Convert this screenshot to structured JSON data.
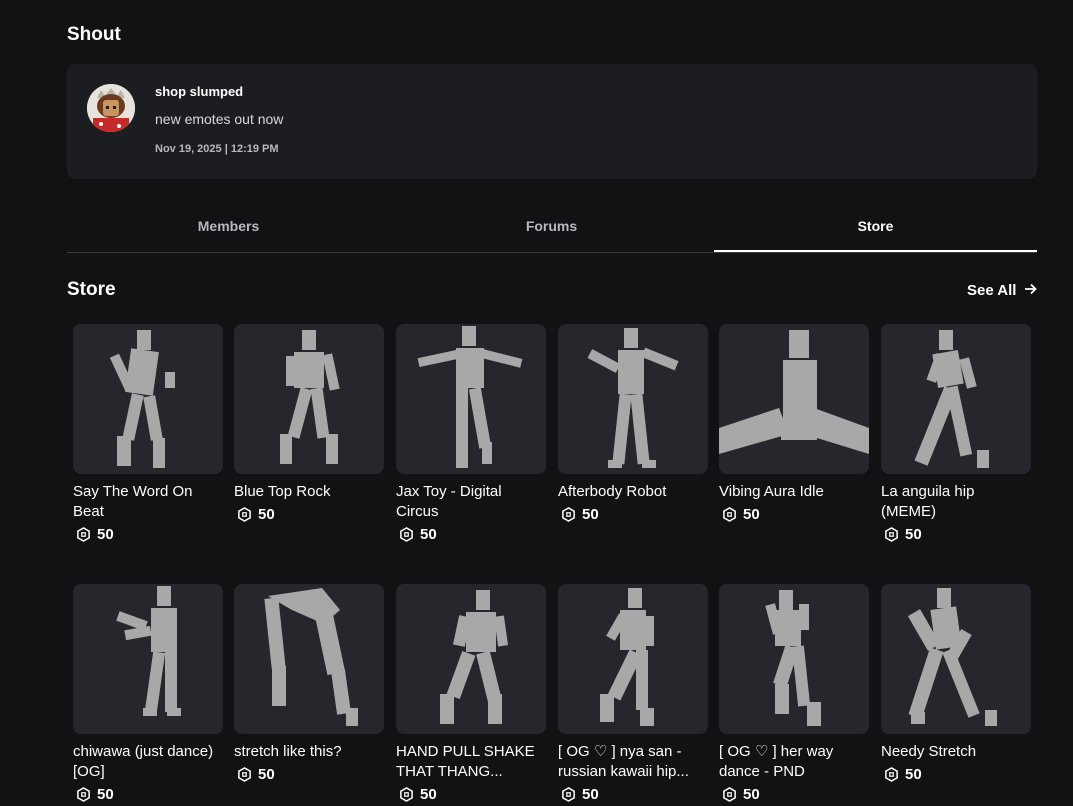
{
  "shout": {
    "title": "Shout",
    "user": "shop slumped",
    "message": "new emotes out now",
    "time": "Nov 19, 2025 | 12:19 PM"
  },
  "tabs": [
    {
      "label": "Members",
      "active": false
    },
    {
      "label": "Forums",
      "active": false
    },
    {
      "label": "Store",
      "active": true
    }
  ],
  "store": {
    "title": "Store",
    "see_all": "See All",
    "items": [
      {
        "name": "Say The Word On Beat",
        "price": "50",
        "icon": "emote-figure-icon"
      },
      {
        "name": "Blue Top Rock",
        "price": "50",
        "icon": "emote-figure-icon"
      },
      {
        "name": "Jax Toy - Digital Circus",
        "price": "50",
        "icon": "emote-figure-icon"
      },
      {
        "name": "Afterbody Robot",
        "price": "50",
        "icon": "emote-figure-icon"
      },
      {
        "name": "Vibing Aura Idle",
        "price": "50",
        "icon": "emote-figure-icon"
      },
      {
        "name": "La anguila hip (MEME)",
        "price": "50",
        "icon": "emote-figure-icon"
      },
      {
        "name": "chiwawa (just dance) [OG]",
        "price": "50",
        "icon": "emote-figure-icon"
      },
      {
        "name": "stretch like this?",
        "price": "50",
        "icon": "emote-figure-icon"
      },
      {
        "name": "HAND PULL SHAKE THAT THANG...",
        "price": "50",
        "icon": "emote-figure-icon"
      },
      {
        "name": "[ OG ♡ ] nya san - russian kawaii hip...",
        "price": "50",
        "icon": "emote-figure-icon"
      },
      {
        "name": "[ OG ♡ ] her way dance - PND",
        "price": "50",
        "icon": "emote-figure-icon"
      },
      {
        "name": "Needy Stretch",
        "price": "50",
        "icon": "emote-figure-icon"
      }
    ]
  },
  "colors": {
    "background": "#111214",
    "card": "#1c1d21",
    "thumb": "#25272c",
    "figure": "#a8a8a8"
  }
}
